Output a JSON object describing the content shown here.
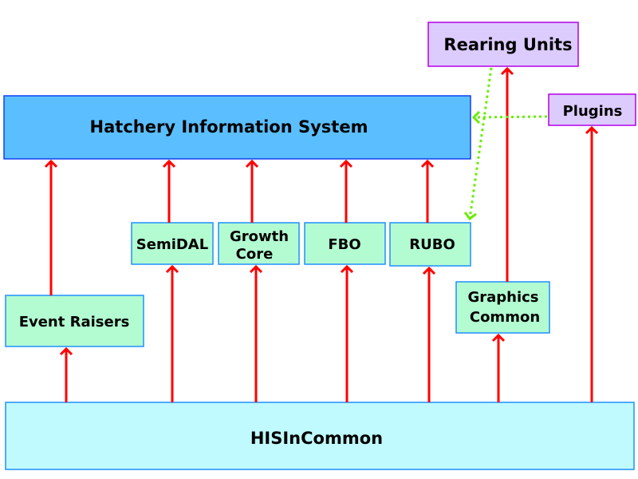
{
  "colors": {
    "main_system": "#5bbfff",
    "component": "#b3fcd1",
    "external": "#dccbfd",
    "common": "#c0faff",
    "dependency_arrow": "#ff0000",
    "plugin_arrow": "#66ee00"
  },
  "nodes": {
    "rearing_units": "Rearing Units",
    "plugins": "Plugins",
    "his": "Hatchery Information System",
    "semidal": "SemiDAL",
    "growth_core_1": "Growth",
    "growth_core_2": "Core",
    "fbo": "FBO",
    "rubo": "RUBO",
    "event_raisers": "Event Raisers",
    "graphics_common_1": "Graphics",
    "graphics_common_2": "Common",
    "hisincommon": "HISInCommon"
  }
}
